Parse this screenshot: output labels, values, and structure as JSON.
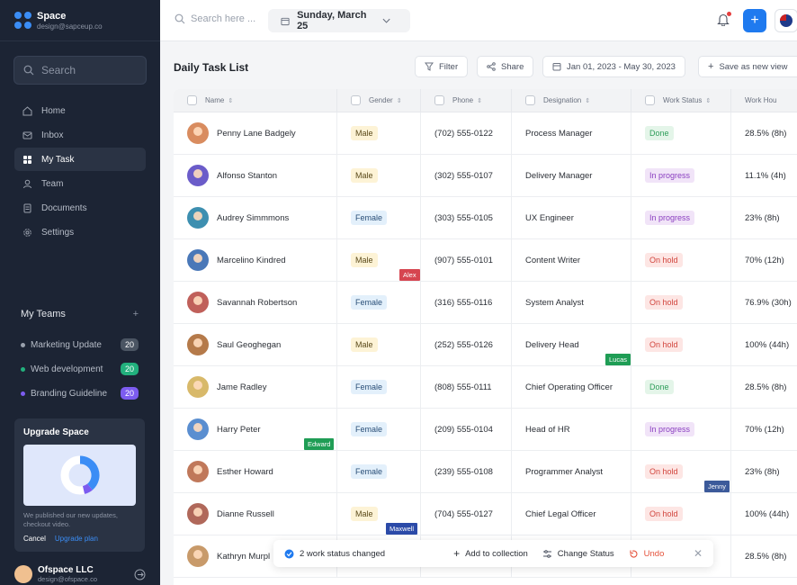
{
  "sidebar": {
    "brand_name": "Space",
    "brand_email": "design@sapceup.co",
    "search_placeholder": "Search",
    "nav": [
      {
        "label": "Home",
        "icon": "home-icon"
      },
      {
        "label": "Inbox",
        "icon": "inbox-icon"
      },
      {
        "label": "My Task",
        "icon": "task-icon",
        "active": true
      },
      {
        "label": "Team",
        "icon": "user-icon"
      },
      {
        "label": "Documents",
        "icon": "document-icon"
      },
      {
        "label": "Settings",
        "icon": "gear-icon"
      }
    ],
    "teams_title": "My Teams",
    "teams": [
      {
        "name": "Marketing Update",
        "count": "20",
        "dot": "#9aa1ad",
        "badge": "#6b7280"
      },
      {
        "name": "Web development",
        "count": "20",
        "dot": "#22b07d",
        "badge": "#22b07d"
      },
      {
        "name": "Branding Guideline",
        "count": "20",
        "dot": "#7c5cf0",
        "badge": "#7c5cf0"
      }
    ],
    "upgrade": {
      "title": "Upgrade Space",
      "text": "We published our new updates, checkout video.",
      "cancel": "Cancel",
      "plan": "Upgrade plan"
    },
    "user": {
      "name": "Ofspace LLC",
      "email": "design@ofspace.co"
    }
  },
  "topbar": {
    "search_placeholder": "Search here ...",
    "date": "Sunday, March 25"
  },
  "toolbar": {
    "title": "Daily Task List",
    "filter": "Filter",
    "share": "Share",
    "range": "Jan 01, 2023 - May 30, 2023",
    "save_view": "Save as new view"
  },
  "table": {
    "headers": {
      "name": "Name",
      "gender": "Gender",
      "phone": "Phone",
      "designation": "Designation",
      "status": "Work Status",
      "hours": "Work Hou"
    },
    "rows": [
      {
        "name": "Penny Lane Badgely",
        "gender": "Male",
        "phone": "(702) 555-0122",
        "designation": "Process Manager",
        "status": "Done",
        "hours": "28.5% (8h)",
        "avatar": "#d98c5f"
      },
      {
        "name": "Alfonso Stanton",
        "gender": "Male",
        "phone": "(302) 555-0107",
        "designation": "Delivery Manager",
        "status": "In progress",
        "hours": "11.1% (4h)",
        "avatar": "#6b5cc9"
      },
      {
        "name": "Audrey Simmmons",
        "gender": "Female",
        "phone": "(303) 555-0105",
        "designation": "UX Engineer",
        "status": "In progress",
        "hours": "23% (8h)",
        "avatar": "#3d8fb0"
      },
      {
        "name": "Marcelino Kindred",
        "gender": "Male",
        "phone": "(907) 555-0101",
        "designation": "Content Writer",
        "status": "On hold",
        "hours": "70% (12h)",
        "avatar": "#4a78b8"
      },
      {
        "name": "Savannah Robertson",
        "gender": "Female",
        "phone": "(316) 555-0116",
        "designation": "System Analyst",
        "status": "On hold",
        "hours": "76.9% (30h)",
        "avatar": "#c0605a"
      },
      {
        "name": "Saul Geoghegan",
        "gender": "Male",
        "phone": "(252) 555-0126",
        "designation": "Delivery Head",
        "status": "On hold",
        "hours": "100% (44h)",
        "avatar": "#b57a4a"
      },
      {
        "name": "Jame Radley",
        "gender": "Female",
        "phone": "(808) 555-0111",
        "designation": "Chief Operating Officer",
        "status": "Done",
        "hours": "28.5% (8h)",
        "avatar": "#d8b96a"
      },
      {
        "name": "Harry Peter",
        "gender": "Female",
        "phone": "(209) 555-0104",
        "designation": "Head of HR",
        "status": "In progress",
        "hours": "70% (12h)",
        "avatar": "#5a8ed0"
      },
      {
        "name": "Esther Howard",
        "gender": "Female",
        "phone": "(239) 555-0108",
        "designation": "Programmer Analyst",
        "status": "On hold",
        "hours": "23% (8h)",
        "avatar": "#c0785a"
      },
      {
        "name": "Dianne Russell",
        "gender": "Male",
        "phone": "(704) 555-0127",
        "designation": "Chief Legal Officer",
        "status": "On hold",
        "hours": "100% (44h)",
        "avatar": "#b0685a"
      },
      {
        "name": "Kathryn Murpl",
        "gender": "",
        "phone": "",
        "designation": "",
        "status": "",
        "hours": "28.5% (8h)",
        "avatar": "#c89a6a"
      }
    ]
  },
  "cursors": [
    {
      "label": "Alex",
      "color": "#d64550"
    },
    {
      "label": "Lucas",
      "color": "#1f9d55"
    },
    {
      "label": "Edward",
      "color": "#1f9d55"
    },
    {
      "label": "Jenny",
      "color": "#3c5a9a"
    },
    {
      "label": "Maxwell",
      "color": "#2b4aa8"
    }
  ],
  "toast": {
    "message": "2 work status changed",
    "add": "Add to collection",
    "change": "Change Status",
    "undo": "Undo"
  },
  "colors": {
    "sidebar_bg": "#1c2434",
    "accent": "#1f7aef",
    "male_bg": "#fdf3d6",
    "female_bg": "#e3f0fb",
    "done": "#2f9e5a",
    "in_progress": "#8a3fc0",
    "on_hold": "#d1443c"
  }
}
